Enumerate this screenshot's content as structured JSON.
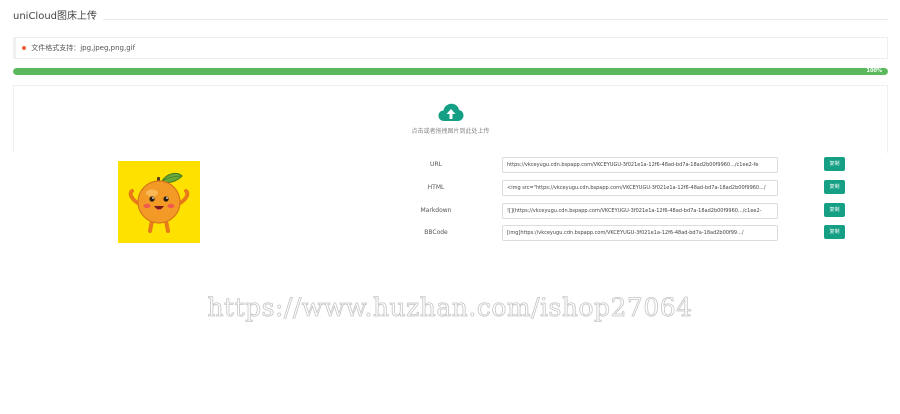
{
  "header": {
    "title": "uniCloud图床上传"
  },
  "notice": {
    "text": "文件格式支持：jpg,jpeg,png,gif"
  },
  "progress": {
    "value": 1.0,
    "label": "100%",
    "color": "#5cb85c"
  },
  "dropzone": {
    "icon": "cloud-upload-icon",
    "text": "点击或者拖拽图片到此处上传",
    "icon_color": "#15a085"
  },
  "preview": {
    "icon": "orange-mascot-image",
    "background": "#ffe100"
  },
  "links": [
    {
      "label": "URL",
      "value": "https://vkceyugu.cdn.bspapp.com/VKCEYUGU-3f021e1a-12f6-48ad-bd7a-18ad2b00f9960.../c1ee2-fe",
      "button": "复制"
    },
    {
      "label": "HTML",
      "value": "<img src=\"https://vkceyugu.cdn.bspapp.com/VKCEYUGU-3f021e1a-12f6-48ad-bd7a-18ad2b00f9960.../",
      "button": "复制"
    },
    {
      "label": "Markdown",
      "value": "![](https://vkceyugu.cdn.bspapp.com/VKCEYUGU-3f021e1a-12f6-48ad-bd7a-18ad2b00f9960.../c1ee2-",
      "button": "复制"
    },
    {
      "label": "BBCode",
      "value": "[img]https://vkceyugu.cdn.bspapp.com/VKCEYUGU-3f021e1a-12f6-48ad-bd7a-18ad2b00f99.../",
      "button": "复制"
    }
  ],
  "watermark": {
    "text": "https://www.huzhan.com/ishop27064"
  },
  "colors": {
    "accent": "#15a085",
    "notice_dot": "#e8613a"
  }
}
